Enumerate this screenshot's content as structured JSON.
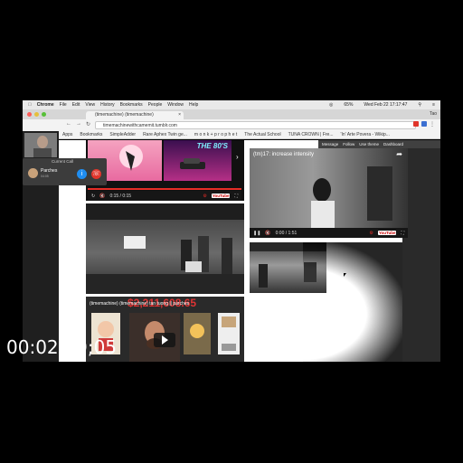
{
  "menubar": {
    "apple": "",
    "app": "Chrome",
    "items": [
      "File",
      "Edit",
      "View",
      "History",
      "Bookmarks",
      "People",
      "Window",
      "Help"
    ],
    "battery": "65%",
    "datetime": "Wed Feb 22  17:17:47"
  },
  "browser": {
    "tab_title": "(timemachine) (timemachine)",
    "tab_close": "×",
    "profile": "Tao",
    "url": "timemachinewithcamemit.tumblr.com",
    "bookmarks": [
      "Apps",
      "Bookmarks",
      "SimpleAdder",
      "Rare Aphex Twin ge...",
      "m o n k + p r o p h e t",
      "The Actual School",
      "TUNA CROWN | Fre...",
      "'In' Arte Povera - Wikip..."
    ]
  },
  "tumblr_bar": {
    "items": [
      "Message",
      "Follow",
      "Use theme",
      "Dashboard"
    ]
  },
  "top_left_video": {
    "title": "THE 80'S",
    "time": "0:15 / 0:15",
    "progress": 1.0
  },
  "top_right_video": {
    "title": "(tm)17: increase intensity",
    "time": "0:00 / 1:51",
    "progress": 0.0
  },
  "bottom_left_video": {
    "title": "(timemachine) (timemachine) tan tuong || parches",
    "price_overlay": "$2,211,608.65"
  },
  "youtube_logo": "YouTube",
  "call": {
    "header": "Current Call",
    "name": "Parches",
    "subtitle": "04:05"
  },
  "timecode": "00:02:29;05",
  "colors": {
    "background": "#000000",
    "accent_red": "#e52d27",
    "call_blue": "#1f8ef1",
    "call_red": "#e0352b"
  }
}
